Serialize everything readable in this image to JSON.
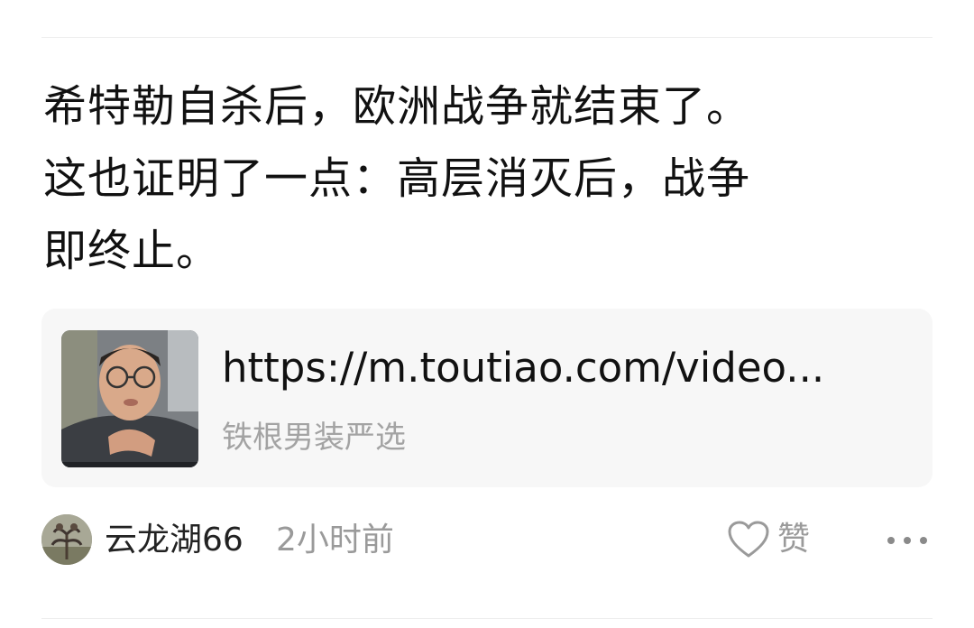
{
  "post": {
    "lines": [
      "希特勒自杀后，欧洲战争就结束了。",
      "这也证明了一点：高层消灭后，战争",
      "即终止。"
    ]
  },
  "link_card": {
    "url": "https://m.toutiao.com/video...",
    "source": "铁根男装严选",
    "thumbnail_icon": "video-thumbnail-man-with-glasses"
  },
  "author": {
    "name": "云龙湖66",
    "time": "2小时前",
    "avatar_icon": "avatar-plant-photo"
  },
  "actions": {
    "like_label": "赞",
    "like_icon": "heart-outline-icon",
    "more_icon": "more-dots-icon"
  },
  "colors": {
    "text_primary": "#111111",
    "text_secondary": "#9a9a9a",
    "card_bg": "#f7f7f7"
  }
}
